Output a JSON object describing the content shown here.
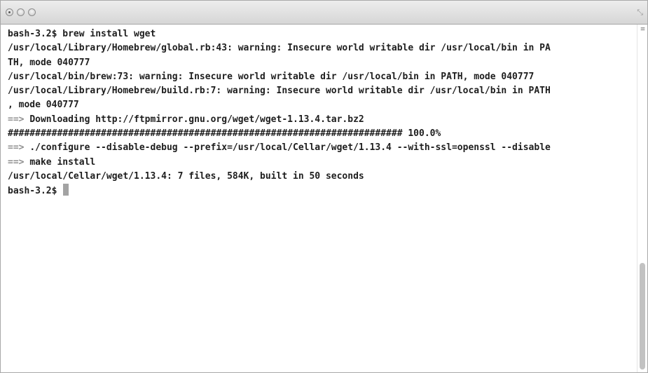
{
  "window": {
    "resize_glyph": "⤡"
  },
  "terminal": {
    "prompt": "bash-3.2$",
    "lines": [
      "bash-3.2$ brew install wget",
      "/usr/local/Library/Homebrew/global.rb:43: warning: Insecure world writable dir /usr/local/bin in PA",
      "TH, mode 040777",
      "/usr/local/bin/brew:73: warning: Insecure world writable dir /usr/local/bin in PATH, mode 040777",
      "/usr/local/Library/Homebrew/build.rb:7: warning: Insecure world writable dir /usr/local/bin in PATH",
      ", mode 040777",
      {
        "arrow": "==>",
        "text": "Downloading http://ftpmirror.gnu.org/wget/wget-1.13.4.tar.bz2"
      },
      "######################################################################## 100.0%",
      {
        "arrow": "==>",
        "text": "./configure --disable-debug --prefix=/usr/local/Cellar/wget/1.13.4 --with-ssl=openssl --disable"
      },
      {
        "arrow": "==>",
        "text": "make install"
      },
      "/usr/local/Cellar/wget/1.13.4: 7 files, 584K, built in 50 seconds"
    ]
  },
  "scrollbar": {
    "menu_glyph": "≡"
  }
}
